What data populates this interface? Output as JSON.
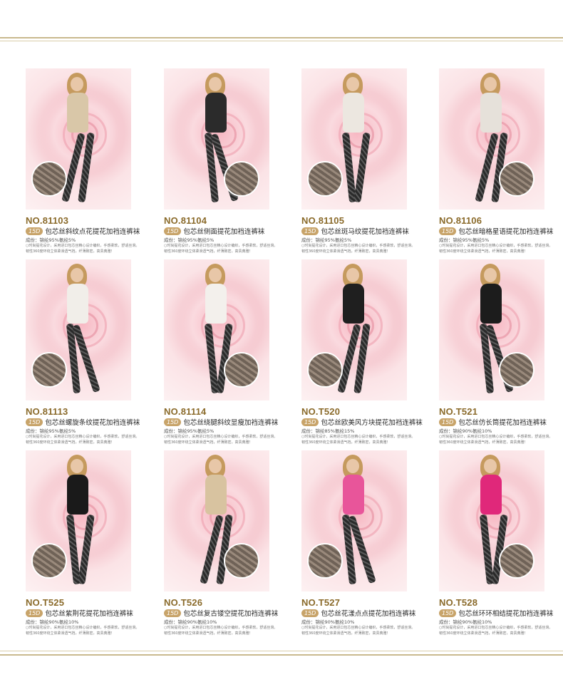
{
  "products": [
    {
      "code": "NO.81103",
      "badge": "15D",
      "title": "包芯丝斜纹点花提花加裆连裤袜",
      "composition": "成份：锦纶95%氨纶5%",
      "desc1": "○时尚提花设计，采用进口包芯丝精心设计编织，手感柔软，舒适丝滑。",
      "desc2": "韧性360度环绕立体柔滑透气裆，纤薄致密，高贵典雅！",
      "dress": "#d9c7a8"
    },
    {
      "code": "NO.81104",
      "badge": "15D",
      "title": "包芯丝侧面提花加裆连裤袜",
      "composition": "成份：锦纶95%氨纶5%",
      "desc1": "○时尚提花设计，采用进口包芯丝精心设计编织，手感柔软，舒适丝滑。",
      "desc2": "韧性360度环绕立体柔滑透气裆，纤薄致密，高贵典雅！",
      "dress": "#2b2b2b"
    },
    {
      "code": "NO.81105",
      "badge": "15D",
      "title": "包芯丝斑马纹提花加裆连裤袜",
      "composition": "成份：锦纶95%氨纶5%",
      "desc1": "○时尚提花设计，采用进口包芯丝精心设计编织，手感柔软，舒适丝滑。",
      "desc2": "韧性360度环绕立体柔滑透气裆，纤薄致密，高贵典雅！",
      "dress": "#ece7e0"
    },
    {
      "code": "NO.81106",
      "badge": "15D",
      "title": "包芯丝暗格星语提花加裆连裤袜",
      "composition": "成份：锦纶95%氨纶5%",
      "desc1": "○时尚提花设计，采用进口包芯丝精心设计编织，手感柔软，舒适丝滑。",
      "desc2": "韧性360度环绕立体柔滑透气裆，纤薄致密，高贵典雅！",
      "dress": "#e6e1da"
    },
    {
      "code": "NO.81113",
      "badge": "15D",
      "title": "包芯丝螺旋条纹提花加裆连裤袜",
      "composition": "成份：锦纶95%氨纶5%",
      "desc1": "○时尚提花设计，采用进口包芯丝精心设计编织，手感柔软，舒适丝滑。",
      "desc2": "韧性360度环绕立体柔滑透气裆，纤薄致密，高贵典雅！",
      "dress": "#f1eee9"
    },
    {
      "code": "NO.81114",
      "badge": "15D",
      "title": "包芯丝绕腿斜纹显瘦加裆连裤袜",
      "composition": "成份：锦纶95%氨纶5%",
      "desc1": "○时尚提花设计，采用进口包芯丝精心设计编织，手感柔软，舒适丝滑。",
      "desc2": "韧性360度环绕立体柔滑透气裆，纤薄致密，高贵典雅！",
      "dress": "#f3f0ec"
    },
    {
      "code": "NO.T520",
      "badge": "15D",
      "title": "包芯丝欧美风方块提花加裆连裤袜",
      "composition": "成份：锦纶85%氨纶15%",
      "desc1": "○时尚提花设计，采用进口包芯丝精心设计编织，手感柔软，舒适丝滑。",
      "desc2": "韧性360度环绕立体柔滑透气裆，纤薄致密，高贵典雅！",
      "dress": "#1f1f1f"
    },
    {
      "code": "NO.T521",
      "badge": "15D",
      "title": "包芯丝仿长筒提花加裆连裤袜",
      "composition": "成份：锦纶90%氨纶10%",
      "desc1": "○时尚提花设计，采用进口包芯丝精心设计编织，手感柔软，舒适丝滑。",
      "desc2": "韧性360度环绕立体柔滑透气裆，纤薄致密，高贵典雅！",
      "dress": "#1c1c1c"
    },
    {
      "code": "NO.T525",
      "badge": "15D",
      "title": "包芯丝紫荆花提花加裆连裤袜",
      "composition": "成份：锦纶90%氨纶10%",
      "desc1": "○时尚提花设计，采用进口包芯丝精心设计编织，手感柔软，舒适丝滑。",
      "desc2": "韧性360度环绕立体柔滑透气裆，纤薄致密，高贵典雅！",
      "dress": "#1a1a1a"
    },
    {
      "code": "NO.T526",
      "badge": "15D",
      "title": "包芯丝复古镂空提花加裆连裤袜",
      "composition": "成份：锦纶90%氨纶10%",
      "desc1": "○时尚提花设计，采用进口包芯丝精心设计编织，手感柔软，舒适丝滑。",
      "desc2": "韧性360度环绕立体柔滑透气裆，纤薄致密，高贵典雅！",
      "dress": "#d8c3a0"
    },
    {
      "code": "NO.T527",
      "badge": "15D",
      "title": "包芯丝花漾点点提花加裆连裤袜",
      "composition": "成份：锦纶90%氨纶10%",
      "desc1": "○时尚提花设计，采用进口包芯丝精心设计编织，手感柔软，舒适丝滑。",
      "desc2": "韧性360度环绕立体柔滑透气裆，纤薄致密，高贵典雅！",
      "dress": "#e8559a"
    },
    {
      "code": "NO.T528",
      "badge": "15D",
      "title": "包芯丝环环相结提花加裆连裤袜",
      "composition": "成份：锦纶90%氨纶10%",
      "desc1": "○时尚提花设计，采用进口包芯丝精心设计编织，手感柔软，舒适丝滑。",
      "desc2": "韧性360度环绕立体柔滑透气裆，纤薄致密，高贵典雅！",
      "dress": "#e0287a"
    }
  ]
}
